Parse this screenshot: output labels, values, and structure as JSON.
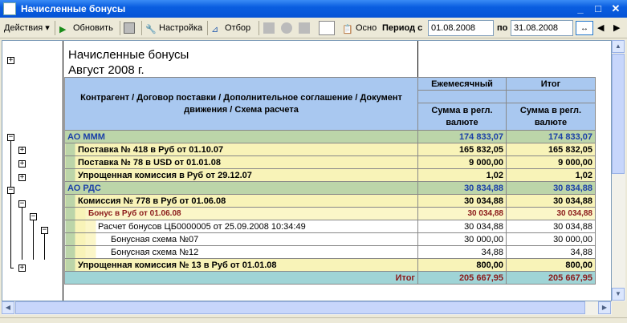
{
  "window": {
    "title": "Начисленные бонусы"
  },
  "toolbar": {
    "actions": "Действия",
    "refresh": "Обновить",
    "settings": "Настройка",
    "filter": "Отбор",
    "basis": "Осно",
    "period_label": "Период с",
    "date_from": "01.08.2008",
    "to_label": "по",
    "date_to": "31.08.2008"
  },
  "report": {
    "title": "Начисленные бонусы",
    "subtitle": "Август 2008 г.",
    "header": {
      "main": "Контрагент / Договор поставки / Дополнительное соглашение / Документ движения / Схема расчета",
      "col1": "Ежемесячный",
      "col2": "Итог",
      "sub1": "Сумма в регл. валюте",
      "sub2": "Сумма в регл. валюте"
    },
    "rows": [
      {
        "label": "АО МММ",
        "v1": "174 833,07",
        "v2": "174 833,07"
      },
      {
        "label": "Поставка № 418 в Руб от 01.10.07",
        "v1": "165 832,05",
        "v2": "165 832,05"
      },
      {
        "label": "Поставка № 78 в USD от 01.01.08",
        "v1": "9 000,00",
        "v2": "9 000,00"
      },
      {
        "label": "Упрощенная комиссия в Руб от 29.12.07",
        "v1": "1,02",
        "v2": "1,02"
      },
      {
        "label": "АО РДС",
        "v1": "30 834,88",
        "v2": "30 834,88"
      },
      {
        "label": "Комиссия № 778 в Руб от 01.06.08",
        "v1": "30 034,88",
        "v2": "30 034,88"
      },
      {
        "label": "Бонус в Руб от 01.06.08",
        "v1": "30 034,88",
        "v2": "30 034,88"
      },
      {
        "label": "Расчет бонусов ЦБ0000005 от 25.09.2008 10:34:49",
        "v1": "30 034,88",
        "v2": "30 034,88"
      },
      {
        "label": "Бонусная схема №07",
        "v1": "30 000,00",
        "v2": "30 000,00"
      },
      {
        "label": "Бонусная схема №12",
        "v1": "34,88",
        "v2": "34,88"
      },
      {
        "label": "Упрощенная комиссия № 13 в Руб от 01.01.08",
        "v1": "800,00",
        "v2": "800,00"
      }
    ],
    "total": {
      "label": "Итог",
      "v1": "205 667,95",
      "v2": "205 667,95"
    }
  }
}
